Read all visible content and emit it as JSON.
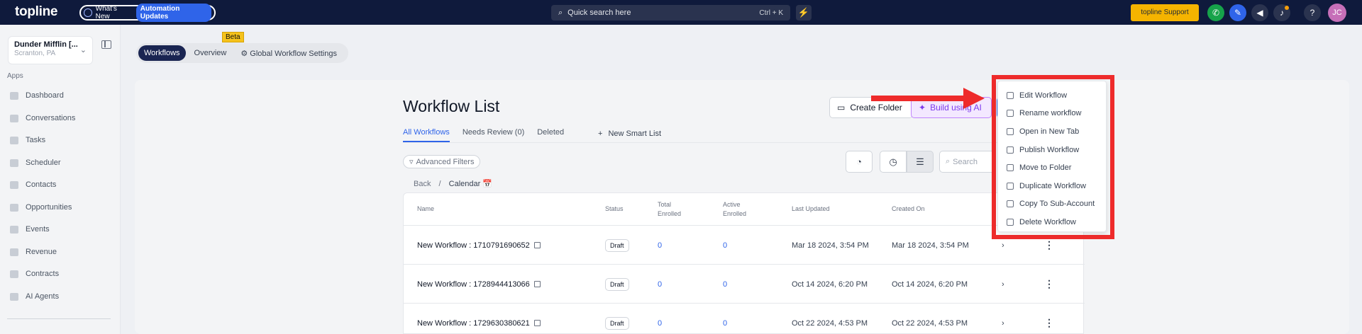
{
  "topbar": {
    "logo": "topline",
    "whats_new": "What's New",
    "automation_updates": "Automation Updates",
    "search_placeholder": "Quick search here",
    "search_shortcut": "Ctrl + K",
    "support": "topline Support",
    "avatar_initials": "JC"
  },
  "sidebar": {
    "account_name": "Dunder Mifflin [...",
    "account_location": "Scranton, PA",
    "apps_label": "Apps",
    "items": [
      {
        "label": "Dashboard"
      },
      {
        "label": "Conversations"
      },
      {
        "label": "Tasks"
      },
      {
        "label": "Scheduler"
      },
      {
        "label": "Contacts"
      },
      {
        "label": "Opportunities"
      },
      {
        "label": "Events"
      },
      {
        "label": "Revenue"
      },
      {
        "label": "Contracts"
      },
      {
        "label": "AI Agents"
      }
    ]
  },
  "tabs": {
    "workflows": "Workflows",
    "overview": "Overview",
    "global": "Global Workflow Settings",
    "beta": "Beta"
  },
  "main": {
    "title": "Workflow List",
    "create_folder": "Create Folder",
    "build_ai": "Build using AI",
    "subtabs": [
      "All Workflows",
      "Needs Review (0)",
      "Deleted"
    ],
    "new_smart_list": "New Smart List",
    "advanced_filters": "Advanced Filters",
    "search_placeholder": "Search",
    "breadcrumb_back": "Back",
    "breadcrumb_sep": "/",
    "breadcrumb_current": "Calendar 📅"
  },
  "table": {
    "headers": {
      "name": "Name",
      "status": "Status",
      "total_enrolled": "Total Enrolled",
      "active_enrolled": "Active Enrolled",
      "last_updated": "Last Updated",
      "created_on": "Created On"
    },
    "rows": [
      {
        "name": "New Workflow : 1710791690652",
        "status": "Draft",
        "total": "0",
        "active": "0",
        "updated": "Mar 18 2024, 3:54 PM",
        "created": "Mar 18 2024, 3:54 PM"
      },
      {
        "name": "New Workflow : 1728944413066",
        "status": "Draft",
        "total": "0",
        "active": "0",
        "updated": "Oct 14 2024, 6:20 PM",
        "created": "Oct 14 2024, 6:20 PM"
      },
      {
        "name": "New Workflow : 1729630380621",
        "status": "Draft",
        "total": "0",
        "active": "0",
        "updated": "Oct 22 2024, 4:53 PM",
        "created": "Oct 22 2024, 4:53 PM"
      }
    ]
  },
  "menu": {
    "items": [
      {
        "label": "Edit Workflow",
        "icon": "pencil-icon"
      },
      {
        "label": "Rename workflow",
        "icon": "edit-icon"
      },
      {
        "label": "Open in New Tab",
        "icon": "external-link-icon"
      },
      {
        "label": "Publish Workflow",
        "icon": "play-icon"
      },
      {
        "label": "Move to Folder",
        "icon": "folder-icon"
      },
      {
        "label": "Duplicate Workflow",
        "icon": "duplicate-icon"
      },
      {
        "label": "Copy To Sub-Account",
        "icon": "copy-icon"
      },
      {
        "label": "Delete Workflow",
        "icon": "trash-icon"
      }
    ]
  },
  "colors": {
    "accent": "#2f64e9",
    "topbar": "#0f1a3c",
    "highlight": "#ee2b2b"
  }
}
